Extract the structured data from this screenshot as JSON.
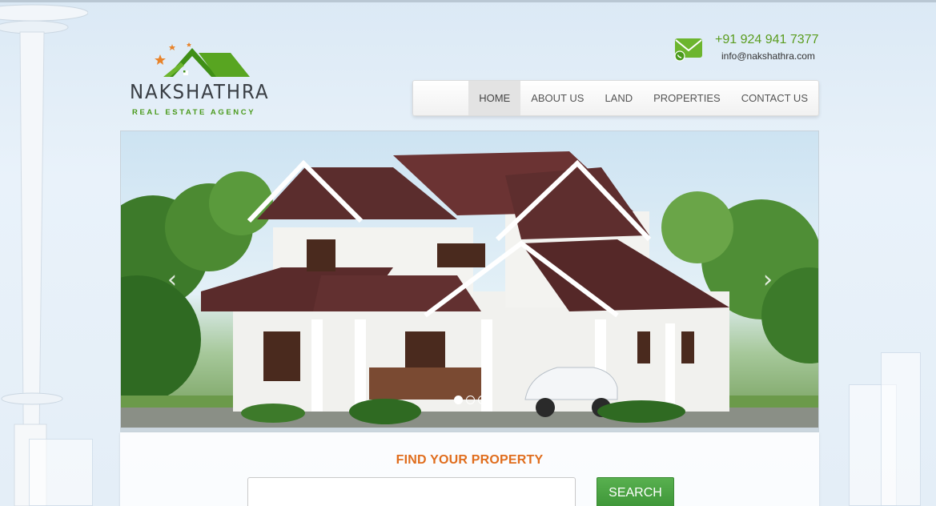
{
  "brand": {
    "name": "NAKSHATHRA",
    "tagline": "REAL  ESTATE  AGENCY",
    "green": "#4a9a1c",
    "orange": "#e8832a"
  },
  "contact": {
    "phone": "+91 924 941 7377",
    "email": "info@nakshathra.com",
    "icon": "mail-phone-icon"
  },
  "nav": {
    "items": [
      {
        "label": "HOME",
        "active": true
      },
      {
        "label": "ABOUT US"
      },
      {
        "label": "LAND"
      },
      {
        "label": "PROPERTIES"
      },
      {
        "label": "CONTACT US"
      }
    ]
  },
  "hero": {
    "prev_icon": "chevron-left-icon",
    "next_icon": "chevron-right-icon",
    "slides_total": 3,
    "active_slide": 1
  },
  "search": {
    "title": "FIND YOUR PROPERTY",
    "placeholder": "",
    "button_label": "SEARCH",
    "accent": "#e06d1d"
  }
}
